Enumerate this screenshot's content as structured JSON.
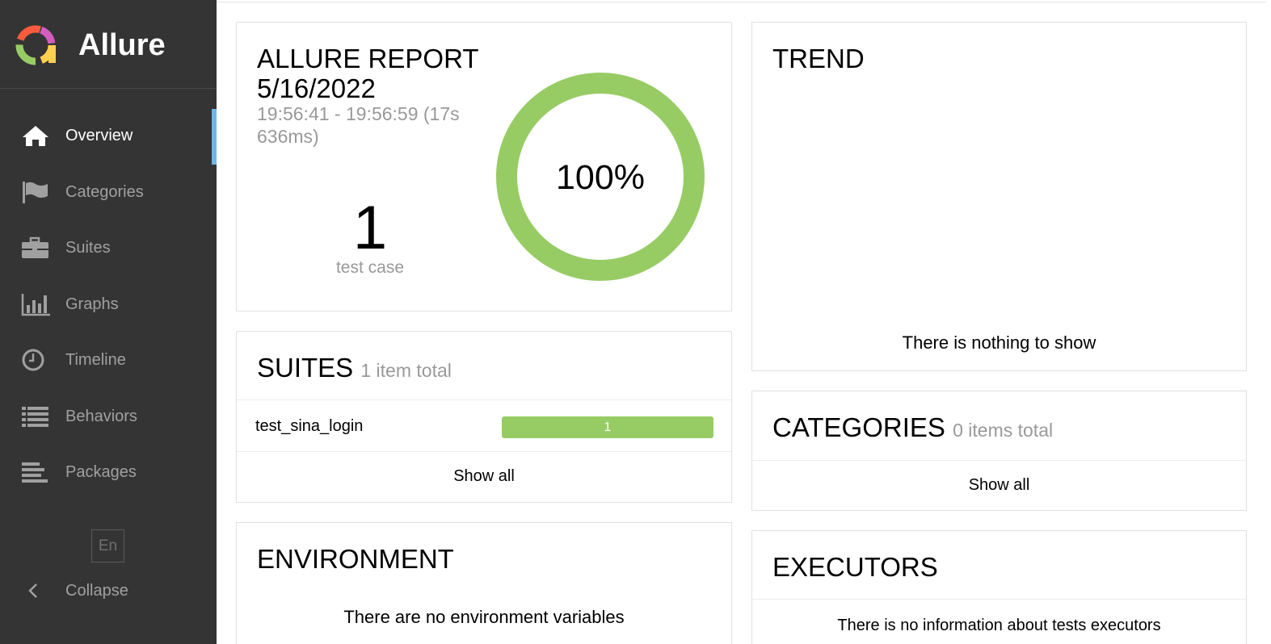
{
  "app": {
    "name": "Allure"
  },
  "sidebar": {
    "items": [
      {
        "label": "Overview",
        "icon": "home-icon",
        "active": true
      },
      {
        "label": "Categories",
        "icon": "flag-icon"
      },
      {
        "label": "Suites",
        "icon": "briefcase-icon"
      },
      {
        "label": "Graphs",
        "icon": "bar-chart-icon"
      },
      {
        "label": "Timeline",
        "icon": "clock-icon"
      },
      {
        "label": "Behaviors",
        "icon": "list-icon"
      },
      {
        "label": "Packages",
        "icon": "align-left-icon"
      }
    ],
    "language": "En",
    "collapse_label": "Collapse"
  },
  "summary": {
    "title_line1": "ALLURE REPORT",
    "title_line2": "5/16/2022",
    "time_line1": "19:56:41 - 19:56:59 (17s",
    "time_line2": "636ms)",
    "test_count": "1",
    "test_count_label": "test case",
    "percent": "100%",
    "pass_fraction": 1.0,
    "pass_color": "#97cc64"
  },
  "trend": {
    "title": "TREND",
    "empty_text": "There is nothing to show"
  },
  "suites": {
    "title": "SUITES",
    "subtitle": "1 item total",
    "rows": [
      {
        "name": "test_sina_login",
        "passed": "1"
      }
    ],
    "show_all": "Show all"
  },
  "categories": {
    "title": "CATEGORIES",
    "subtitle": "0 items total",
    "show_all": "Show all"
  },
  "environment": {
    "title": "ENVIRONMENT",
    "empty_text": "There are no environment variables"
  },
  "executors": {
    "title": "EXECUTORS",
    "empty_text": "There is no information about tests executors"
  }
}
